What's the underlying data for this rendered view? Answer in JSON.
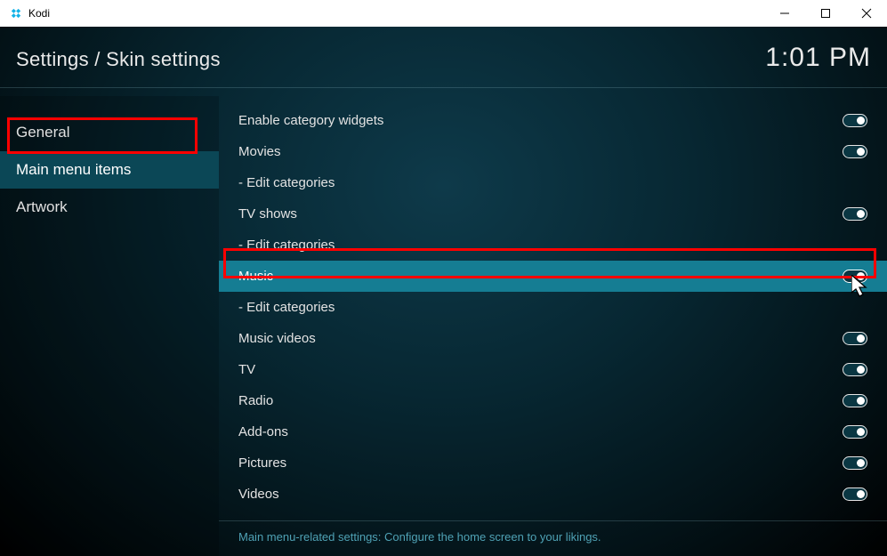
{
  "window_title": "Kodi",
  "breadcrumb": "Settings / Skin settings",
  "time": "1:01 PM",
  "sidebar": {
    "items": [
      {
        "label": "General",
        "active": false
      },
      {
        "label": "Main menu items",
        "active": true
      },
      {
        "label": "Artwork",
        "active": false
      }
    ]
  },
  "settings": [
    {
      "label": "Enable category widgets",
      "type": "toggle",
      "on": true,
      "highlighted": false
    },
    {
      "label": "Movies",
      "type": "toggle",
      "on": true,
      "highlighted": false
    },
    {
      "label": "- Edit categories",
      "type": "link",
      "highlighted": false
    },
    {
      "label": "TV shows",
      "type": "toggle",
      "on": true,
      "highlighted": false
    },
    {
      "label": "- Edit categories",
      "type": "link",
      "highlighted": false
    },
    {
      "label": "Music",
      "type": "toggle",
      "on": true,
      "highlighted": true
    },
    {
      "label": "- Edit categories",
      "type": "link",
      "highlighted": false
    },
    {
      "label": "Music videos",
      "type": "toggle",
      "on": true,
      "highlighted": false
    },
    {
      "label": "TV",
      "type": "toggle",
      "on": true,
      "highlighted": false
    },
    {
      "label": "Radio",
      "type": "toggle",
      "on": true,
      "highlighted": false
    },
    {
      "label": "Add-ons",
      "type": "toggle",
      "on": true,
      "highlighted": false
    },
    {
      "label": "Pictures",
      "type": "toggle",
      "on": true,
      "highlighted": false
    },
    {
      "label": "Videos",
      "type": "toggle",
      "on": true,
      "highlighted": false
    }
  ],
  "footer_text": "Main menu-related settings: Configure the home screen to your likings."
}
